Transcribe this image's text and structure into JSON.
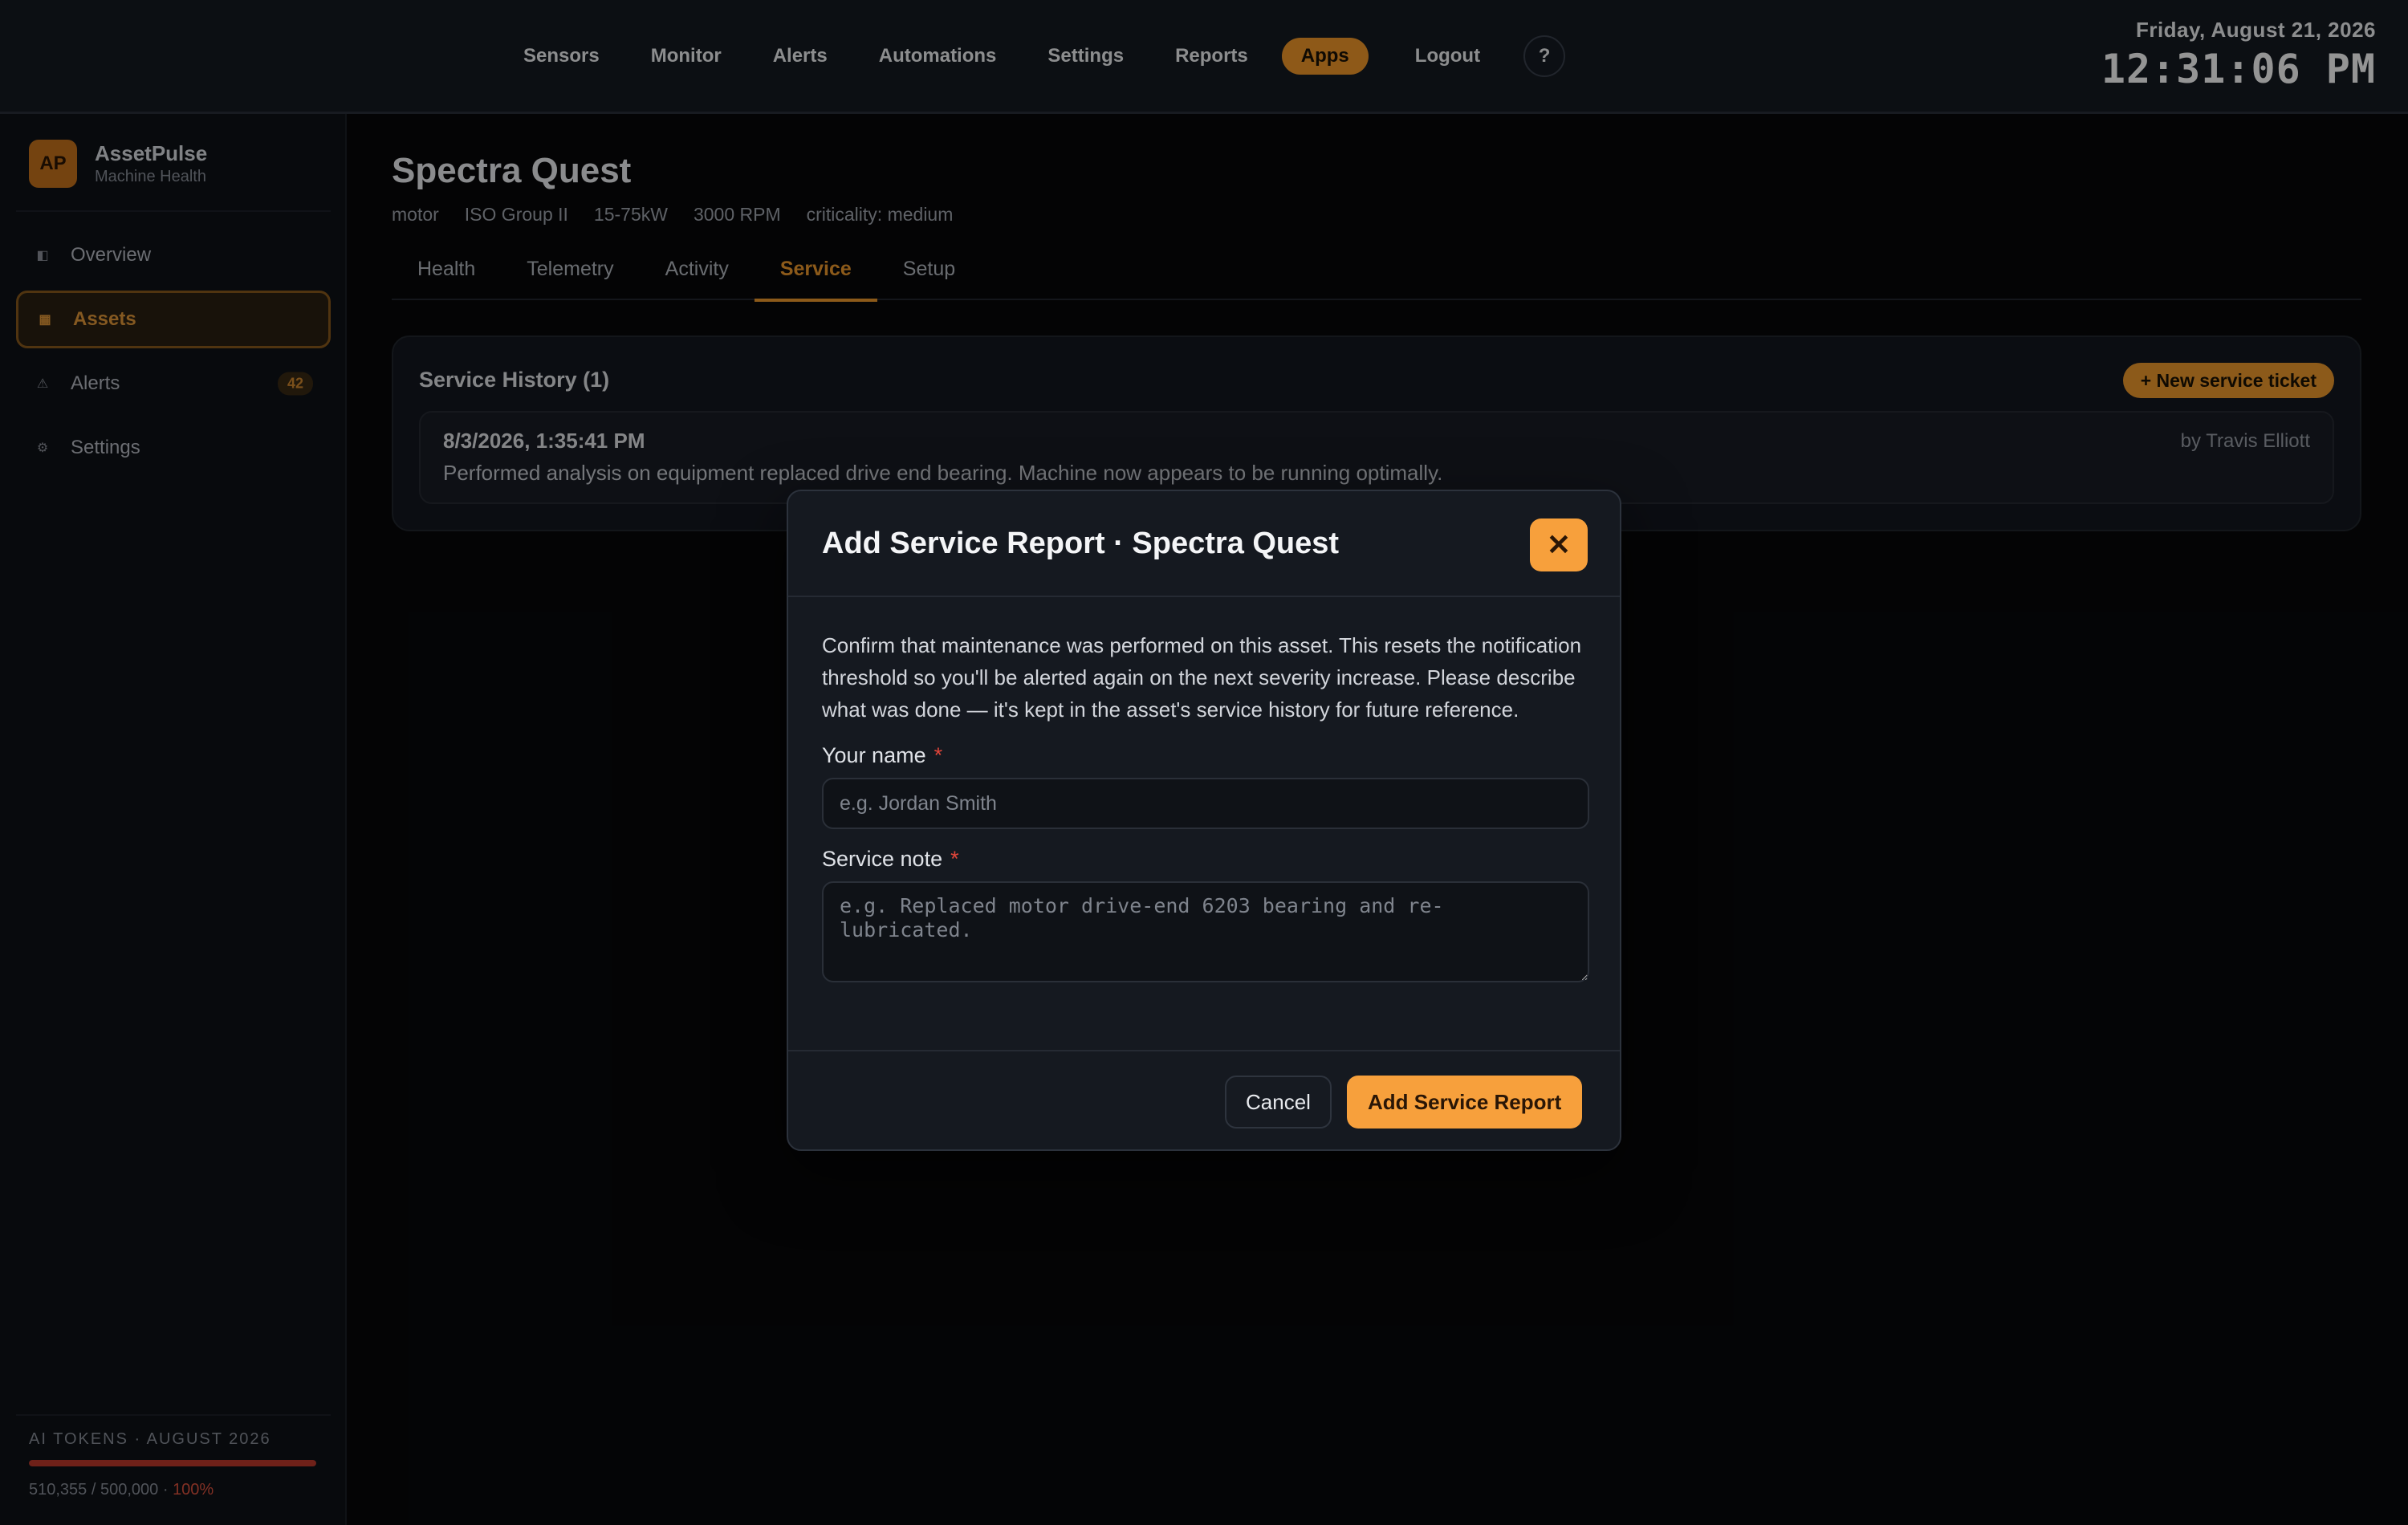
{
  "topnav": {
    "items": [
      "Sensors",
      "Monitor",
      "Alerts",
      "Automations",
      "Settings",
      "Reports",
      "Apps",
      "Logout"
    ],
    "active": "Apps",
    "help_label": "?"
  },
  "clock": {
    "date": "Friday, August 21, 2026",
    "time": "12:31:06 PM"
  },
  "brand": {
    "logo": "AP",
    "name": "AssetPulse",
    "subtitle": "Machine Health"
  },
  "sidebar": {
    "items": [
      {
        "label": "Overview",
        "icon": "overview-icon",
        "glyph": "◧"
      },
      {
        "label": "Assets",
        "icon": "grid-icon",
        "glyph": "▦"
      },
      {
        "label": "Alerts",
        "icon": "warning-icon",
        "glyph": "⚠",
        "badge": "42"
      },
      {
        "label": "Settings",
        "icon": "gear-icon",
        "glyph": "⚙"
      }
    ],
    "active": "Assets"
  },
  "tokens": {
    "title": "AI TOKENS · AUGUST 2026",
    "used": "510,355",
    "limit": "500,000",
    "percent_label": "100%",
    "fill_fraction": 1.0,
    "bar_color": "#c0392b"
  },
  "asset": {
    "name": "Spectra Quest",
    "tags": [
      "motor",
      "ISO Group II",
      "15-75kW",
      "3000 RPM",
      "criticality: medium"
    ]
  },
  "tabs": {
    "items": [
      "Health",
      "Telemetry",
      "Activity",
      "Service",
      "Setup"
    ],
    "active": "Service"
  },
  "service_history": {
    "title": "Service History (1)",
    "new_ticket_label": "+ New service ticket",
    "entries": [
      {
        "date": "8/3/2026, 1:35:41 PM",
        "author": "by Travis Elliott",
        "note": "Performed analysis on equipment replaced drive end bearing.  Machine now appears to be running optimally."
      }
    ]
  },
  "modal": {
    "title": "Add Service Report · Spectra Quest",
    "close_glyph": "✕",
    "description": "Confirm that maintenance was performed on this asset. This resets the notification threshold so you'll be alerted again on the next severity increase. Please describe what was done — it's kept in the asset's service history for future reference.",
    "name_label": "Your name",
    "name_placeholder": "e.g. Jordan Smith",
    "name_value": "",
    "note_label": "Service note",
    "note_placeholder": "e.g. Replaced motor drive-end 6203 bearing and re-lubricated.",
    "note_value": "",
    "required_mark": "*",
    "cancel_label": "Cancel",
    "submit_label": "Add Service Report"
  },
  "colors": {
    "accent": "#f29b2e",
    "danger": "#e0453a",
    "background": "#07080a"
  }
}
